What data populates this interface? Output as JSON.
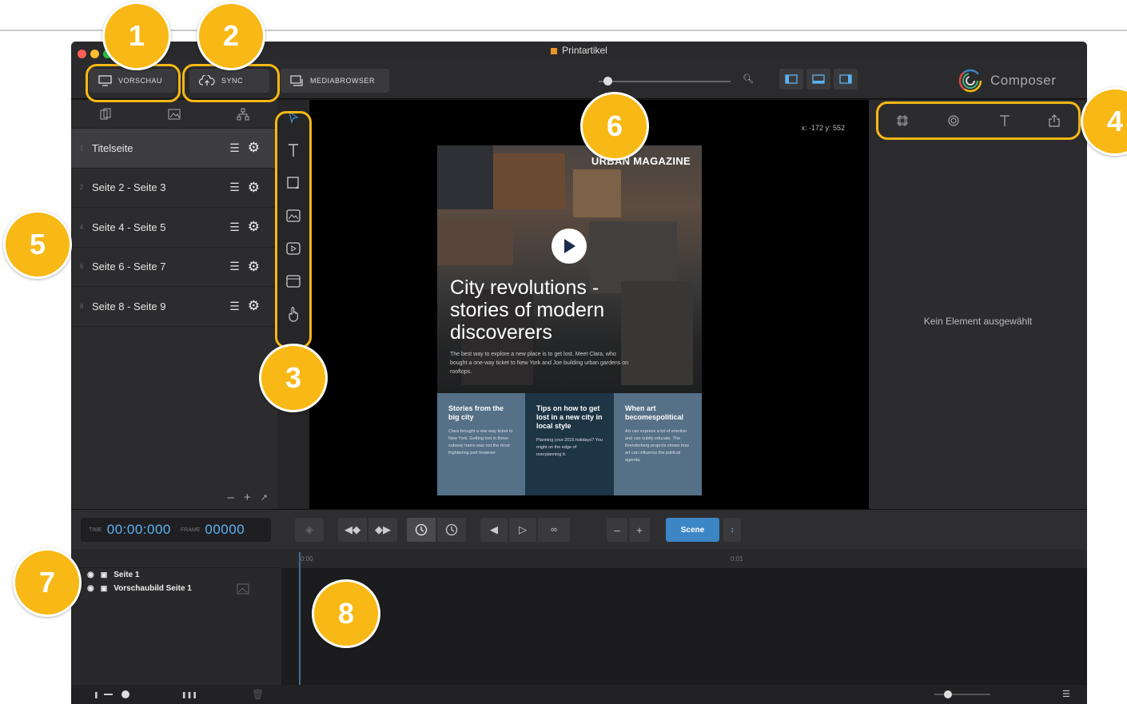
{
  "window": {
    "title": "Printartikel"
  },
  "toolbar": {
    "preview_label": "VORSCHAU",
    "sync_label": "SYNC",
    "mediabrowser_label": "MEDIABROWSER",
    "brand": "Composer"
  },
  "pages": [
    {
      "num": "1",
      "label": "Titelseite"
    },
    {
      "num": "2",
      "label": "Seite 2 - Seite 3"
    },
    {
      "num": "4",
      "label": "Seite 4 - Seite 5"
    },
    {
      "num": "6",
      "label": "Seite 6 - Seite 7"
    },
    {
      "num": "8",
      "label": "Seite 8 - Seite 9"
    }
  ],
  "canvas": {
    "coords": "x: -172 y: 552",
    "magazine": "URBAN MAGAZINE",
    "headline": "City revolutions - stories of modern discoverers",
    "lead": "The best way to explore a new place is to get lost. Meet Clara, who bought a one-way ticket to New York and Joe building urban gardens on rooftops.",
    "columns": [
      {
        "title": "Stories from the big city",
        "text": "Clara brought a one way ticket to New York. Getting lost in those subway trains was not the most frightening part however."
      },
      {
        "title": "Tips on how to get lost in a new city in local style",
        "text": "Planning your 2015 holidays? You might on the edge of overplanning it."
      },
      {
        "title": "When art becomespolitical",
        "text": "Art can express a lot of emotion and can subtly educate. The Brenderberg projects shows how art can influence the political agenda."
      }
    ]
  },
  "inspector": {
    "empty_text": "Kein Element ausgewählt"
  },
  "timecontrols": {
    "time_label": "TIME",
    "time_value": "00:00:000",
    "frame_label": "FRAME",
    "frame_value": "00000",
    "scene_label": "Scene"
  },
  "layers": [
    {
      "label": "Seite 1"
    },
    {
      "label": "Vorschaubild Seite 1"
    }
  ],
  "timeline": {
    "mark_start": "0:00",
    "mark_1": "0:01"
  },
  "callouts": [
    "1",
    "2",
    "3",
    "4",
    "5",
    "6",
    "7",
    "8"
  ],
  "colors": {
    "accent": "#f8b815",
    "timecode": "#5cb2f3",
    "scene_button": "#3d86c6"
  }
}
